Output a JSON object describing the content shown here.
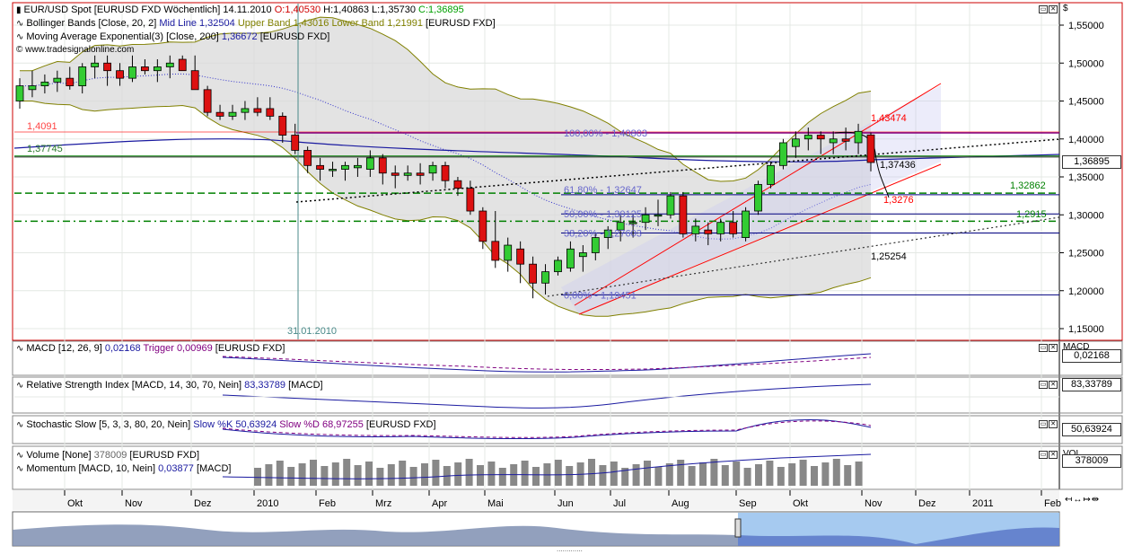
{
  "currency_symbol": "$",
  "watermark": "© www.tradesignalonline.com",
  "legends": {
    "main_symbol": "EUR/USD Spot [EURUSD FXD  Wöchentlich]",
    "main_date": "14.11.2010",
    "main_open": "O:1,40530",
    "main_high": "H:1,40863",
    "main_low": "L:1,35730",
    "main_close": "C:1,36895",
    "bb_name": "Bollinger Bands [Close, 20, 2]",
    "bb_mid": "Mid Line 1,32504",
    "bb_upper": "Upper Band 1,43016",
    "bb_lower": "Lower Band 1,21991",
    "bb_src": "[EURUSD FXD]",
    "ema_name": "Moving Average Exponential(3) [Close, 200]",
    "ema_val": "1,36672",
    "ema_src": "[EURUSD FXD]",
    "macd_name": "MACD [12, 26, 9]",
    "macd_val": "0,02168",
    "macd_trigger": "Trigger 0,00969",
    "macd_src": "[EURUSD FXD]",
    "rsi_name": "Relative Strength Index [MACD, 14, 30, 70, Nein]",
    "rsi_val": "83,33789",
    "rsi_src": "[MACD]",
    "stoch_name": "Stochastic Slow [5, 3, 3, 80, 20, Nein]",
    "stoch_k": "Slow %K 50,63924",
    "stoch_d": "Slow %D 68,97255",
    "stoch_src": "[EURUSD FXD]",
    "vol_name": "Volume [None]",
    "vol_val": "378009",
    "vol_src": "[EURUSD FXD]",
    "mom_name": "Momentum [MACD, 10, Nein]",
    "mom_val": "0,03877",
    "mom_src": "[MACD]"
  },
  "right_panel": {
    "last_price": "1,36895",
    "macd_title": "MACD",
    "macd_value": "0,02168",
    "rsi_value": "83,33789",
    "stoch_value": "50,63924",
    "vol_title": "VOL",
    "vol_value": "378009"
  },
  "annotations": {
    "hline_1409": "1,4091",
    "hline_13774": "1,37745",
    "fib_100": "100,00% - 1,40803",
    "fib_618": "61,80% - 1,32647",
    "fib_500": "50,00% - 1,30125",
    "fib_382": "38,20% - 1,27603",
    "fib_0": "0,00% - 1,19451",
    "label_143474": "1,43474",
    "label_137436": "1,37436",
    "label_13276": "1,3276",
    "label_132862": "1,32862",
    "label_12915": "1,2915",
    "label_125254": "1,25254",
    "date_marker": "31.01.2010"
  },
  "colors": {
    "up": "#33cc33",
    "down": "#dd1111",
    "bb_band": "#808000",
    "bb_fill": "#d9d9d9",
    "ema": "#1a1aa0",
    "purple": "#800080",
    "green_line": "#008000",
    "red_line": "#ff0000",
    "navy": "#000080",
    "volume_bar": "#888888",
    "nav_fill": "#7f8fb2"
  },
  "chart_data": {
    "type": "candlestick",
    "title": "EUR/USD Spot [EURUSD FXD  Wöchentlich]",
    "ylim": [
      1.13,
      1.565
    ],
    "y_ticks": [
      "1,15000",
      "1,20000",
      "1,25000",
      "1,30000",
      "1,35000",
      "1,40000",
      "1,45000",
      "1,50000",
      "1,55000"
    ],
    "x_months": [
      "Okt",
      "Nov",
      "Dez",
      "2010",
      "Feb",
      "Mrz",
      "Apr",
      "Mai",
      "Jun",
      "Jul",
      "Aug",
      "Sep",
      "Okt",
      "Nov",
      "Dez",
      "2011",
      "Feb"
    ],
    "weekly_ohlc": [
      [
        1.45,
        1.48,
        1.44,
        1.47
      ],
      [
        1.465,
        1.49,
        1.455,
        1.47
      ],
      [
        1.47,
        1.485,
        1.46,
        1.475
      ],
      [
        1.475,
        1.49,
        1.462,
        1.48
      ],
      [
        1.48,
        1.495,
        1.465,
        1.47
      ],
      [
        1.47,
        1.5,
        1.46,
        1.495
      ],
      [
        1.495,
        1.51,
        1.48,
        1.5
      ],
      [
        1.5,
        1.51,
        1.47,
        1.49
      ],
      [
        1.49,
        1.5,
        1.47,
        1.48
      ],
      [
        1.48,
        1.51,
        1.475,
        1.495
      ],
      [
        1.495,
        1.505,
        1.485,
        1.49
      ],
      [
        1.49,
        1.505,
        1.475,
        1.495
      ],
      [
        1.495,
        1.51,
        1.48,
        1.5
      ],
      [
        1.505,
        1.51,
        1.49,
        1.49
      ],
      [
        1.49,
        1.51,
        1.47,
        1.465
      ],
      [
        1.465,
        1.47,
        1.43,
        1.435
      ],
      [
        1.435,
        1.445,
        1.425,
        1.43
      ],
      [
        1.43,
        1.445,
        1.425,
        1.435
      ],
      [
        1.435,
        1.45,
        1.425,
        1.44
      ],
      [
        1.44,
        1.455,
        1.43,
        1.435
      ],
      [
        1.44,
        1.455,
        1.425,
        1.43
      ],
      [
        1.43,
        1.435,
        1.395,
        1.405
      ],
      [
        1.405,
        1.42,
        1.38,
        1.385
      ],
      [
        1.385,
        1.39,
        1.355,
        1.365
      ],
      [
        1.365,
        1.375,
        1.345,
        1.36
      ],
      [
        1.36,
        1.37,
        1.35,
        1.36
      ],
      [
        1.36,
        1.37,
        1.345,
        1.365
      ],
      [
        1.362,
        1.375,
        1.35,
        1.365
      ],
      [
        1.36,
        1.385,
        1.35,
        1.375
      ],
      [
        1.375,
        1.38,
        1.34,
        1.355
      ],
      [
        1.355,
        1.365,
        1.335,
        1.352
      ],
      [
        1.352,
        1.365,
        1.345,
        1.355
      ],
      [
        1.355,
        1.368,
        1.34,
        1.352
      ],
      [
        1.355,
        1.37,
        1.345,
        1.365
      ],
      [
        1.365,
        1.37,
        1.335,
        1.345
      ],
      [
        1.345,
        1.35,
        1.325,
        1.335
      ],
      [
        1.335,
        1.345,
        1.3,
        1.305
      ],
      [
        1.305,
        1.31,
        1.255,
        1.265
      ],
      [
        1.265,
        1.305,
        1.23,
        1.24
      ],
      [
        1.24,
        1.27,
        1.225,
        1.26
      ],
      [
        1.255,
        1.265,
        1.21,
        1.235
      ],
      [
        1.235,
        1.245,
        1.19,
        1.21
      ],
      [
        1.21,
        1.235,
        1.195,
        1.225
      ],
      [
        1.225,
        1.245,
        1.22,
        1.24
      ],
      [
        1.23,
        1.265,
        1.225,
        1.255
      ],
      [
        1.245,
        1.26,
        1.225,
        1.25
      ],
      [
        1.25,
        1.275,
        1.24,
        1.27
      ],
      [
        1.27,
        1.285,
        1.255,
        1.28
      ],
      [
        1.28,
        1.3,
        1.265,
        1.29
      ],
      [
        1.29,
        1.3,
        1.27,
        1.29
      ],
      [
        1.29,
        1.31,
        1.28,
        1.3
      ],
      [
        1.3,
        1.32,
        1.285,
        1.3
      ],
      [
        1.3,
        1.33,
        1.295,
        1.325
      ],
      [
        1.325,
        1.33,
        1.27,
        1.275
      ],
      [
        1.275,
        1.295,
        1.265,
        1.285
      ],
      [
        1.28,
        1.29,
        1.26,
        1.275
      ],
      [
        1.275,
        1.295,
        1.265,
        1.29
      ],
      [
        1.29,
        1.305,
        1.27,
        1.275
      ],
      [
        1.27,
        1.31,
        1.265,
        1.305
      ],
      [
        1.305,
        1.345,
        1.3,
        1.34
      ],
      [
        1.34,
        1.37,
        1.335,
        1.365
      ],
      [
        1.365,
        1.4,
        1.36,
        1.395
      ],
      [
        1.39,
        1.41,
        1.375,
        1.4
      ],
      [
        1.4,
        1.415,
        1.385,
        1.405
      ],
      [
        1.405,
        1.41,
        1.38,
        1.4
      ],
      [
        1.395,
        1.41,
        1.38,
        1.4
      ],
      [
        1.4,
        1.415,
        1.385,
        1.397
      ],
      [
        1.395,
        1.42,
        1.38,
        1.41
      ],
      [
        1.4053,
        1.40863,
        1.3573,
        1.36895
      ]
    ],
    "price_labels": {
      "last": 1.36895
    }
  }
}
